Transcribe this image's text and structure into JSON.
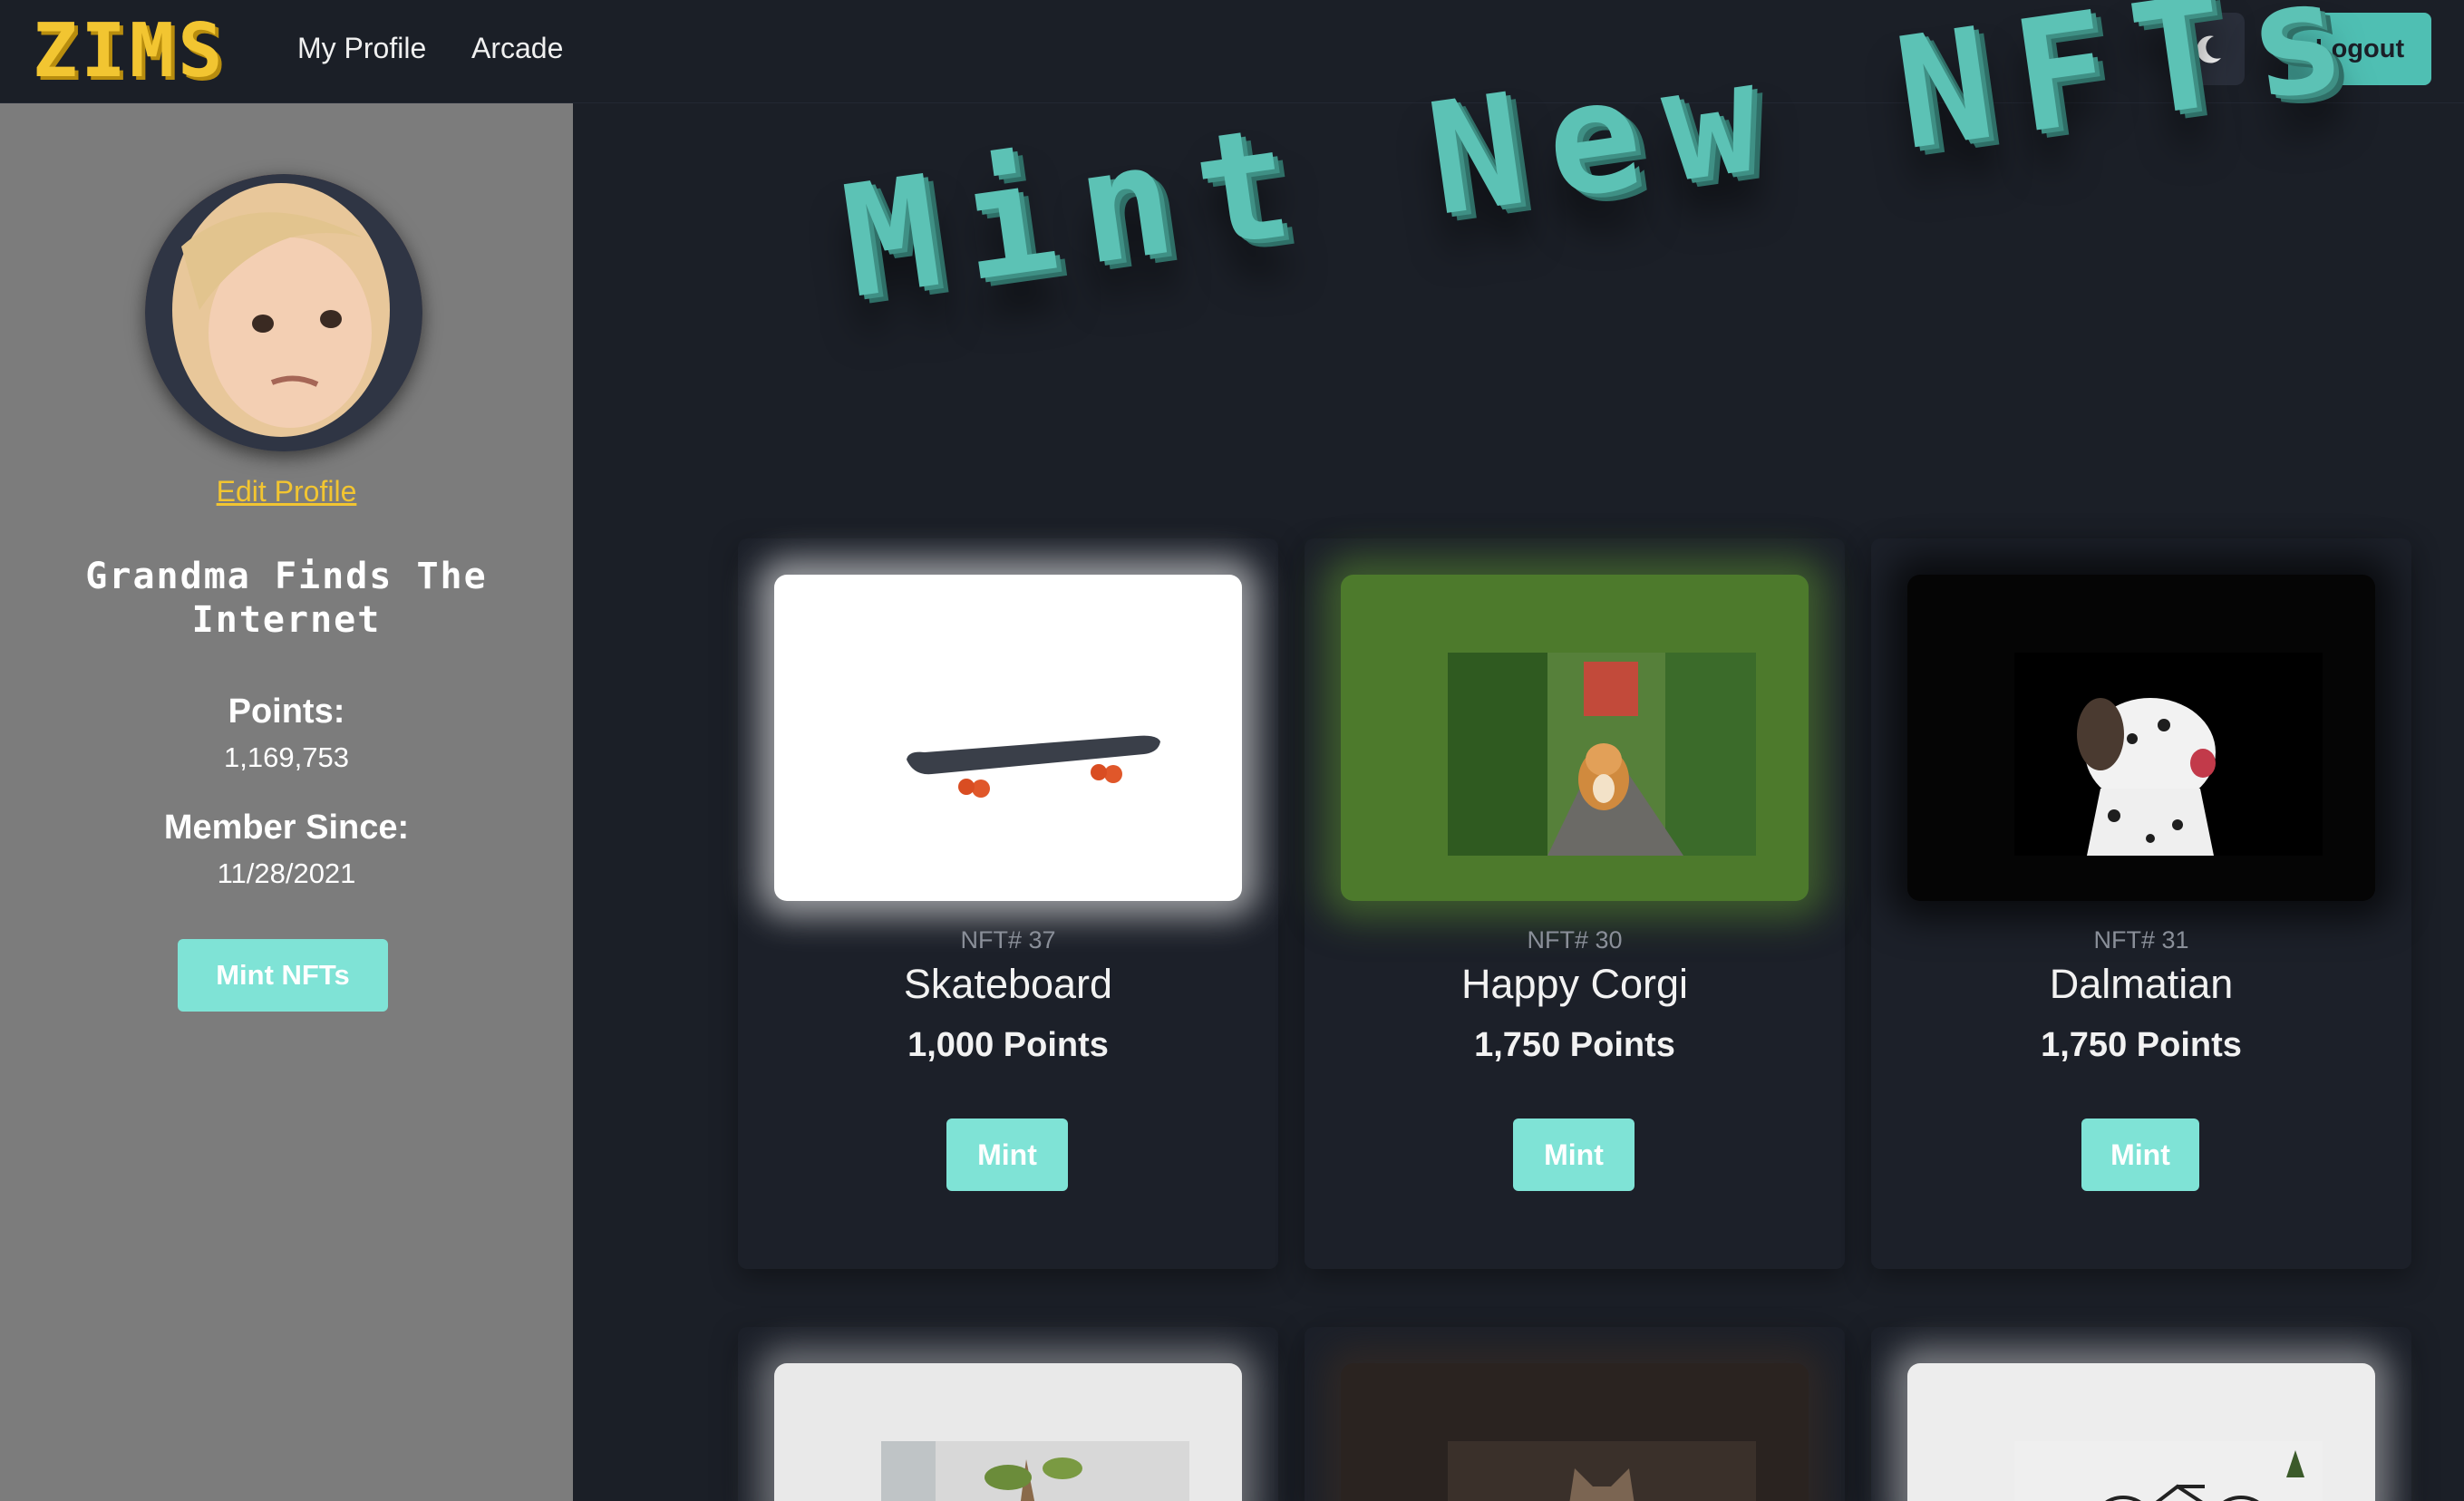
{
  "navbar": {
    "brand": "ZIMS",
    "links": [
      "My Profile",
      "Arcade"
    ],
    "theme_icon": "moon-icon",
    "logout_label": "Logout"
  },
  "sidebar": {
    "edit_profile": "Edit Profile",
    "username": "Grandma Finds The Internet",
    "points_label": "Points:",
    "points_value": "1,169,753",
    "member_label": "Member Since:",
    "member_value": "11/28/2021",
    "mint_button": "Mint NFTs"
  },
  "main": {
    "title": "Mint New NFTs",
    "cards": [
      {
        "id": "NFT# 37",
        "name": "Skateboard",
        "points": "1,000 Points",
        "button": "Mint"
      },
      {
        "id": "NFT# 30",
        "name": "Happy Corgi",
        "points": "1,750 Points",
        "button": "Mint"
      },
      {
        "id": "NFT# 31",
        "name": "Dalmatian",
        "points": "1,750 Points",
        "button": "Mint"
      }
    ]
  },
  "colors": {
    "background": "#1b1f27",
    "accent": "#7fe3d6",
    "brand": "#f2c531",
    "sidebar": "#7c7c7c"
  }
}
